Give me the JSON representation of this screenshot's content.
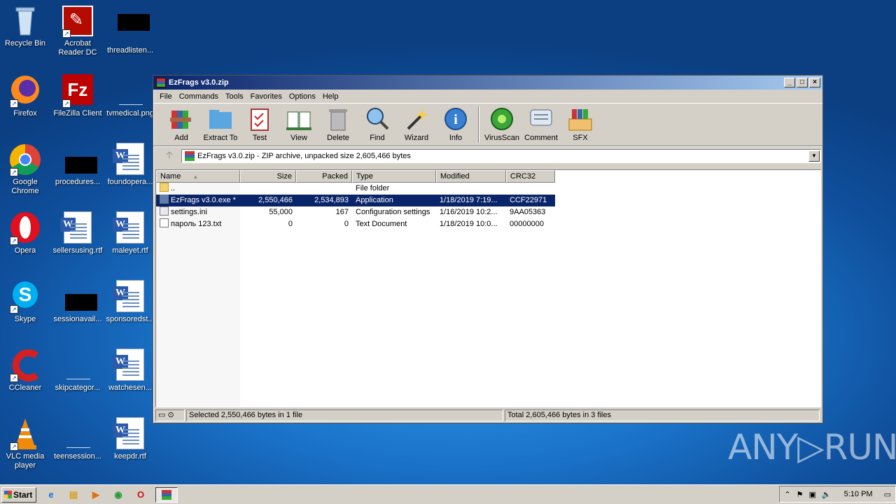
{
  "desktop": {
    "icons": [
      {
        "label": "Recycle Bin"
      },
      {
        "label": "Acrobat Reader DC"
      },
      {
        "label": "threadlisten..."
      },
      {
        "label": "Firefox"
      },
      {
        "label": "FileZilla Client"
      },
      {
        "label": "tvmedical.png"
      },
      {
        "label": "Google Chrome"
      },
      {
        "label": "procedures..."
      },
      {
        "label": "foundopera..."
      },
      {
        "label": "Opera"
      },
      {
        "label": "sellersusing.rtf"
      },
      {
        "label": "maleyet.rtf"
      },
      {
        "label": "Skype"
      },
      {
        "label": "sessionavail..."
      },
      {
        "label": "sponsoredst..."
      },
      {
        "label": "CCleaner"
      },
      {
        "label": "skipcategor..."
      },
      {
        "label": "watchesen..."
      },
      {
        "label": "VLC media player"
      },
      {
        "label": "teensession..."
      },
      {
        "label": "keepdr.rtf"
      }
    ],
    "watermark": "ANY▷RUN"
  },
  "window": {
    "title": "EzFrags v3.0.zip",
    "menu": [
      "File",
      "Commands",
      "Tools",
      "Favorites",
      "Options",
      "Help"
    ],
    "toolbar": [
      "Add",
      "Extract To",
      "Test",
      "View",
      "Delete",
      "Find",
      "Wizard",
      "Info",
      "VirusScan",
      "Comment",
      "SFX"
    ],
    "address": "EzFrags v3.0.zip - ZIP archive, unpacked size 2,605,466 bytes",
    "columns": [
      "Name",
      "Size",
      "Packed",
      "Type",
      "Modified",
      "CRC32"
    ],
    "rows": [
      {
        "name": "..",
        "size": "",
        "packed": "",
        "type": "File folder",
        "modified": "",
        "crc": ""
      },
      {
        "name": "EzFrags v3.0.exe *",
        "size": "2,550,466",
        "packed": "2,534,893",
        "type": "Application",
        "modified": "1/18/2019 7:19...",
        "crc": "CCF22971"
      },
      {
        "name": "settings.ini",
        "size": "55,000",
        "packed": "167",
        "type": "Configuration settings",
        "modified": "1/16/2019 10:2...",
        "crc": "9AA05363"
      },
      {
        "name": "пароль 123.txt",
        "size": "0",
        "packed": "0",
        "type": "Text Document",
        "modified": "1/18/2019 10:0...",
        "crc": "00000000"
      }
    ],
    "status_left": "Selected 2,550,466 bytes in 1 file",
    "status_right": "Total 2,605,466 bytes in 3 files"
  },
  "taskbar": {
    "start": "Start",
    "clock": "5:10 PM"
  }
}
